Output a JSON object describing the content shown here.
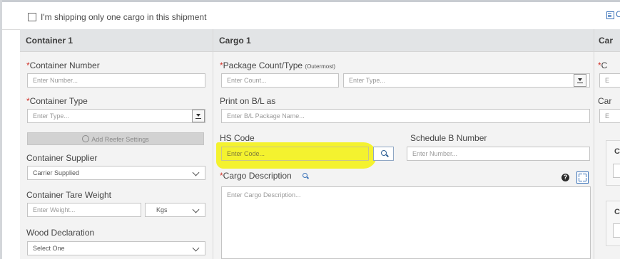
{
  "top": {
    "single_cargo_label": "I'm shipping only one cargo in this shipment",
    "right_link_fragment": "C"
  },
  "container": {
    "title": "Container 1",
    "number": {
      "required_mark": "*",
      "label": "Container Number",
      "placeholder": "Enter Number..."
    },
    "type": {
      "required_mark": "*",
      "label": "Container Type",
      "placeholder": "Enter Type..."
    },
    "reefer_button": "Add Reefer Settings",
    "supplier": {
      "label": "Container Supplier",
      "value": "Carrier Supplied"
    },
    "tare_weight": {
      "label": "Container Tare Weight",
      "placeholder": "Enter Weight...",
      "unit": "Kgs"
    },
    "wood": {
      "label": "Wood Declaration",
      "value": "Select One"
    }
  },
  "cargo": {
    "title": "Cargo 1",
    "package": {
      "required_mark": "*",
      "label": "Package Count/Type",
      "qualifier": "(Outermost)",
      "count_placeholder": "Enter Count...",
      "type_placeholder": "Enter Type..."
    },
    "print_bl": {
      "label": "Print on B/L as",
      "placeholder": "Enter B/L Package Name..."
    },
    "hs_code": {
      "label": "HS Code",
      "placeholder": "Enter Code..."
    },
    "schedule_b": {
      "label": "Schedule B Number",
      "placeholder": "Enter Number..."
    },
    "description": {
      "required_mark": "*",
      "label": "Cargo Description",
      "placeholder": "Enter Cargo Description..."
    },
    "help_glyph": "?"
  },
  "cargo2": {
    "title": "Car",
    "label1": "C",
    "label2": "Car",
    "field1_fragment": "E",
    "field2_fragment": "E",
    "box1_label": "C",
    "box2_label": "C"
  },
  "colors": {
    "highlight": "#f4f21e",
    "required": "#d0332b",
    "accent": "#3b73b9"
  }
}
